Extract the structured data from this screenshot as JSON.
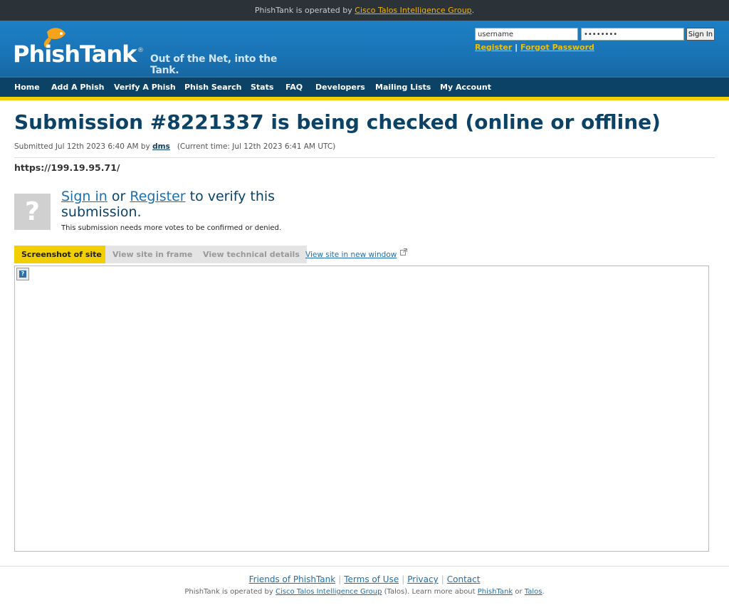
{
  "topbar": {
    "prefix": "PhishTank is operated by",
    "link": "Cisco Talos Intelligence Group",
    "suffix": "."
  },
  "logo": {
    "name": "PhishTank",
    "reg": "®",
    "tagline": "Out of the Net, into the Tank."
  },
  "login": {
    "username_value": "username",
    "password_value": "password",
    "sign_in": "Sign In",
    "register": "Register",
    "separator": "|",
    "forgot": "Forgot Password"
  },
  "nav": {
    "items": [
      "Home",
      "Add A Phish",
      "Verify A Phish",
      "Phish Search",
      "Stats",
      "FAQ",
      "Developers",
      "Mailing Lists",
      "My Account"
    ]
  },
  "submission": {
    "title_bold": "Submission #8221337",
    "title_rest": "is being checked (online or offline)",
    "submitted_prefix": "Submitted Jul 12th 2023 6:40 AM by",
    "submitter": "dms",
    "current_time": "(Current time: Jul 12th 2023 6:41 AM UTC)",
    "url": "https://199.19.95.71/"
  },
  "verify": {
    "question_mark": "?",
    "sign_in": "Sign in",
    "or": "or",
    "register": "Register",
    "rest": "to verify this submission.",
    "note": "This submission needs more votes to be confirmed or denied."
  },
  "tabs": {
    "screenshot": "Screenshot of site",
    "frame": "View site in frame",
    "technical": "View technical details",
    "new_window": "View site in new window"
  },
  "footer": {
    "links": [
      "Friends of PhishTank",
      "Terms of Use",
      "Privacy",
      "Contact"
    ],
    "separator": "|",
    "operated_prefix": "PhishTank is operated by",
    "talos_link": "Cisco Talos Intelligence Group",
    "operated_mid": "(Talos). Learn more about",
    "phishtank_link": "PhishTank",
    "or": "or",
    "talos_short": "Talos",
    "end": "."
  },
  "icons": {
    "logo": "fish-icon",
    "new_window": "external-link-icon",
    "broken_image": "broken-image-icon"
  }
}
